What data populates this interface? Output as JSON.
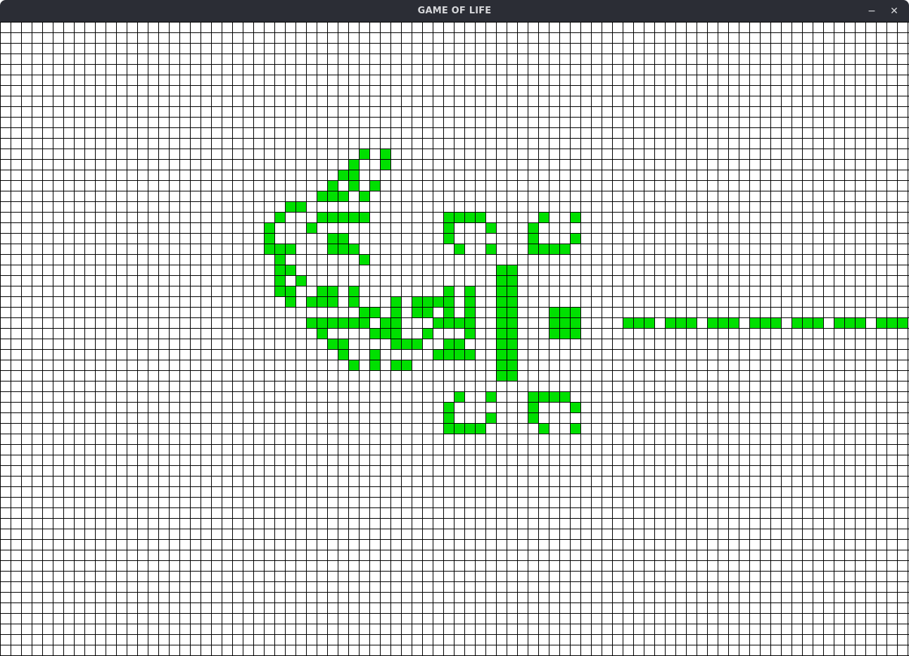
{
  "window": {
    "title": "GAME OF LIFE",
    "minimize_glyph": "−",
    "close_glyph": "✕"
  },
  "grid": {
    "cols": 86,
    "rows": 60,
    "cell_color": "#00e000",
    "line_color": "#000000",
    "background": "#ffffff",
    "live_cells": [
      [
        34,
        12
      ],
      [
        36,
        12
      ],
      [
        33,
        13
      ],
      [
        36,
        13
      ],
      [
        32,
        14
      ],
      [
        33,
        14
      ],
      [
        31,
        15
      ],
      [
        33,
        15
      ],
      [
        35,
        15
      ],
      [
        30,
        16
      ],
      [
        31,
        16
      ],
      [
        32,
        16
      ],
      [
        34,
        16
      ],
      [
        27,
        17
      ],
      [
        28,
        17
      ],
      [
        26,
        18
      ],
      [
        30,
        18
      ],
      [
        31,
        18
      ],
      [
        32,
        18
      ],
      [
        33,
        18
      ],
      [
        34,
        18
      ],
      [
        42,
        18
      ],
      [
        43,
        18
      ],
      [
        44,
        18
      ],
      [
        45,
        18
      ],
      [
        51,
        18
      ],
      [
        54,
        18
      ],
      [
        25,
        19
      ],
      [
        29,
        19
      ],
      [
        42,
        19
      ],
      [
        46,
        19
      ],
      [
        50,
        19
      ],
      [
        25,
        20
      ],
      [
        31,
        20
      ],
      [
        32,
        20
      ],
      [
        42,
        20
      ],
      [
        50,
        20
      ],
      [
        54,
        20
      ],
      [
        25,
        21
      ],
      [
        26,
        21
      ],
      [
        27,
        21
      ],
      [
        31,
        21
      ],
      [
        32,
        21
      ],
      [
        33,
        21
      ],
      [
        43,
        21
      ],
      [
        46,
        21
      ],
      [
        50,
        21
      ],
      [
        51,
        21
      ],
      [
        52,
        21
      ],
      [
        53,
        21
      ],
      [
        26,
        22
      ],
      [
        34,
        22
      ],
      [
        26,
        23
      ],
      [
        27,
        23
      ],
      [
        47,
        23
      ],
      [
        48,
        23
      ],
      [
        26,
        24
      ],
      [
        28,
        24
      ],
      [
        47,
        24
      ],
      [
        48,
        24
      ],
      [
        26,
        25
      ],
      [
        27,
        25
      ],
      [
        30,
        25
      ],
      [
        31,
        25
      ],
      [
        33,
        25
      ],
      [
        42,
        25
      ],
      [
        44,
        25
      ],
      [
        47,
        25
      ],
      [
        48,
        25
      ],
      [
        27,
        26
      ],
      [
        29,
        26
      ],
      [
        30,
        26
      ],
      [
        31,
        26
      ],
      [
        33,
        26
      ],
      [
        37,
        26
      ],
      [
        39,
        26
      ],
      [
        40,
        26
      ],
      [
        41,
        26
      ],
      [
        42,
        26
      ],
      [
        44,
        26
      ],
      [
        47,
        26
      ],
      [
        48,
        26
      ],
      [
        34,
        27
      ],
      [
        35,
        27
      ],
      [
        37,
        27
      ],
      [
        39,
        27
      ],
      [
        40,
        27
      ],
      [
        42,
        27
      ],
      [
        44,
        27
      ],
      [
        47,
        27
      ],
      [
        48,
        27
      ],
      [
        52,
        27
      ],
      [
        53,
        27
      ],
      [
        54,
        27
      ],
      [
        29,
        28
      ],
      [
        30,
        28
      ],
      [
        31,
        28
      ],
      [
        32,
        28
      ],
      [
        33,
        28
      ],
      [
        34,
        28
      ],
      [
        36,
        28
      ],
      [
        37,
        28
      ],
      [
        41,
        28
      ],
      [
        42,
        28
      ],
      [
        43,
        28
      ],
      [
        44,
        28
      ],
      [
        47,
        28
      ],
      [
        48,
        28
      ],
      [
        52,
        28
      ],
      [
        53,
        28
      ],
      [
        54,
        28
      ],
      [
        59,
        28
      ],
      [
        60,
        28
      ],
      [
        61,
        28
      ],
      [
        63,
        28
      ],
      [
        64,
        28
      ],
      [
        65,
        28
      ],
      [
        67,
        28
      ],
      [
        68,
        28
      ],
      [
        69,
        28
      ],
      [
        71,
        28
      ],
      [
        72,
        28
      ],
      [
        73,
        28
      ],
      [
        75,
        28
      ],
      [
        76,
        28
      ],
      [
        77,
        28
      ],
      [
        79,
        28
      ],
      [
        80,
        28
      ],
      [
        81,
        28
      ],
      [
        83,
        28
      ],
      [
        84,
        28
      ],
      [
        85,
        28
      ],
      [
        30,
        29
      ],
      [
        35,
        29
      ],
      [
        36,
        29
      ],
      [
        37,
        29
      ],
      [
        40,
        29
      ],
      [
        44,
        29
      ],
      [
        47,
        29
      ],
      [
        48,
        29
      ],
      [
        52,
        29
      ],
      [
        53,
        29
      ],
      [
        54,
        29
      ],
      [
        31,
        30
      ],
      [
        32,
        30
      ],
      [
        37,
        30
      ],
      [
        38,
        30
      ],
      [
        39,
        30
      ],
      [
        42,
        30
      ],
      [
        43,
        30
      ],
      [
        47,
        30
      ],
      [
        48,
        30
      ],
      [
        32,
        31
      ],
      [
        35,
        31
      ],
      [
        41,
        31
      ],
      [
        42,
        31
      ],
      [
        43,
        31
      ],
      [
        44,
        31
      ],
      [
        47,
        31
      ],
      [
        48,
        31
      ],
      [
        33,
        32
      ],
      [
        35,
        32
      ],
      [
        37,
        32
      ],
      [
        38,
        32
      ],
      [
        47,
        32
      ],
      [
        48,
        32
      ],
      [
        47,
        33
      ],
      [
        48,
        33
      ],
      [
        43,
        35
      ],
      [
        46,
        35
      ],
      [
        50,
        35
      ],
      [
        51,
        35
      ],
      [
        52,
        35
      ],
      [
        53,
        35
      ],
      [
        42,
        36
      ],
      [
        50,
        36
      ],
      [
        54,
        36
      ],
      [
        42,
        37
      ],
      [
        46,
        37
      ],
      [
        50,
        37
      ],
      [
        42,
        38
      ],
      [
        43,
        38
      ],
      [
        44,
        38
      ],
      [
        45,
        38
      ],
      [
        51,
        38
      ],
      [
        54,
        38
      ]
    ]
  }
}
